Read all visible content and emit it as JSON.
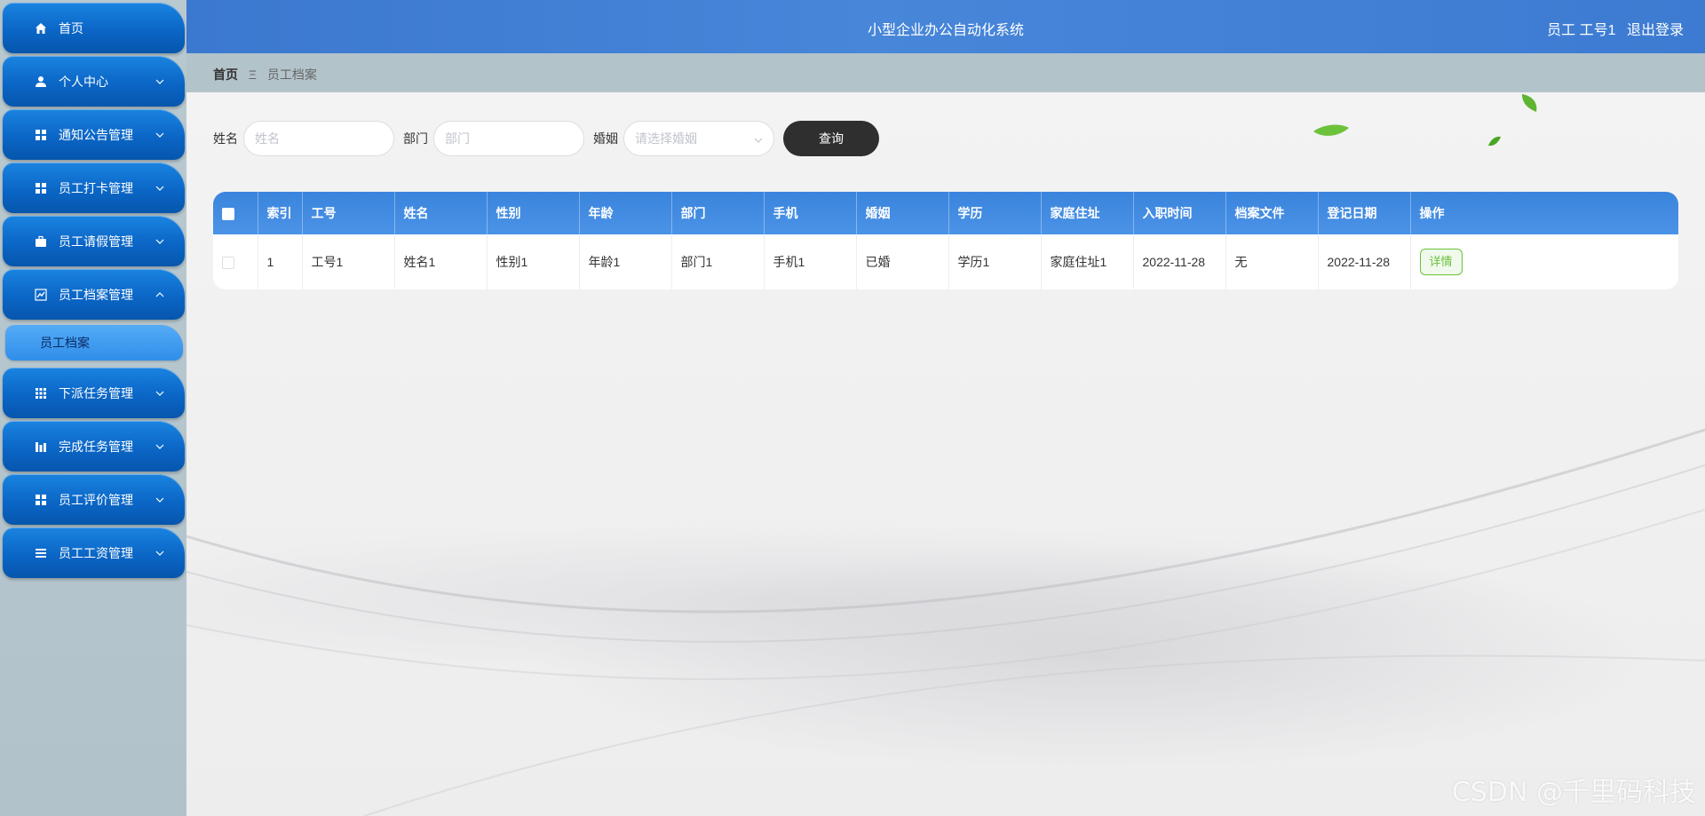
{
  "app": {
    "title": "小型企业办公自动化系统",
    "user_label": "员工 工号1",
    "logout_label": "退出登录"
  },
  "sidebar": {
    "items": [
      {
        "label": "首页",
        "icon": "home-icon",
        "expandable": false
      },
      {
        "label": "个人中心",
        "icon": "user-icon",
        "expandable": true
      },
      {
        "label": "通知公告管理",
        "icon": "grid-icon",
        "expandable": true
      },
      {
        "label": "员工打卡管理",
        "icon": "grid-icon",
        "expandable": true
      },
      {
        "label": "员工请假管理",
        "icon": "briefcase-icon",
        "expandable": true
      },
      {
        "label": "员工档案管理",
        "icon": "chart-icon",
        "expandable": true,
        "expanded": true
      },
      {
        "label": "下派任务管理",
        "icon": "grid-icon",
        "expandable": true
      },
      {
        "label": "完成任务管理",
        "icon": "bar-icon",
        "expandable": true
      },
      {
        "label": "员工评价管理",
        "icon": "grid-icon",
        "expandable": true
      },
      {
        "label": "员工工资管理",
        "icon": "list-icon",
        "expandable": true
      }
    ],
    "submenu": {
      "label": "员工档案"
    }
  },
  "breadcrumb": {
    "home": "首页",
    "separator": "Ξ",
    "current": "员工档案"
  },
  "search": {
    "name_label": "姓名",
    "name_placeholder": "姓名",
    "dept_label": "部门",
    "dept_placeholder": "部门",
    "marriage_label": "婚姻",
    "marriage_placeholder": "请选择婚姻",
    "query_label": "查询"
  },
  "table": {
    "columns": [
      "索引",
      "工号",
      "姓名",
      "性别",
      "年龄",
      "部门",
      "手机",
      "婚姻",
      "学历",
      "家庭住址",
      "入职时间",
      "档案文件",
      "登记日期",
      "操作"
    ],
    "rows": [
      {
        "index": "1",
        "emp_no": "工号1",
        "name": "姓名1",
        "gender": "性别1",
        "age": "年龄1",
        "dept": "部门1",
        "phone": "手机1",
        "marriage": "已婚",
        "education": "学历1",
        "address": "家庭住址1",
        "hire_date": "2022-11-28",
        "file": "无",
        "reg_date": "2022-11-28",
        "action": "详情"
      }
    ]
  },
  "watermark": "CSDN @千里码科技",
  "colors": {
    "header": "#4182d6",
    "sidebar_item": "#0b66c6",
    "table_header": "#3f8ae0",
    "detail_button": "#67c23a",
    "query_button": "#2f2f2f"
  }
}
